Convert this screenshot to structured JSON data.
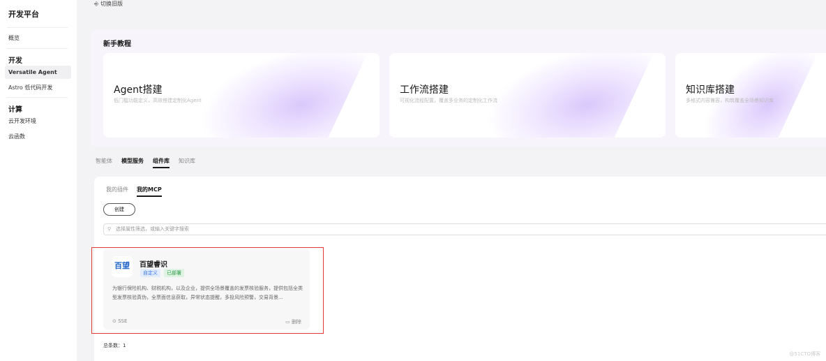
{
  "sidebar": {
    "title": "开发平台",
    "overview": "概览",
    "group_dev": "开发",
    "versatile": "Versatile Agent",
    "astro": "Astro 低代码开发",
    "group_compute": "计算",
    "cloud_dev": "云开发环境",
    "cloud_func": "云函数"
  },
  "header": {
    "switch_label": "切换旧版"
  },
  "tutorial": {
    "title": "新手教程",
    "cards": [
      {
        "title": "Agent搭建",
        "subtitle": "低门槛功能定义，高效搭建定制化Agent"
      },
      {
        "title": "工作流搭建",
        "subtitle": "可视化流程配置，覆盖多业务的定制化工作流"
      },
      {
        "title": "知识库搭建",
        "subtitle": "多格式内容兼容，构筑覆盖全场景知识库"
      }
    ]
  },
  "tabs": [
    "智能体",
    "模型服务",
    "组件库",
    "知识库"
  ],
  "subtabs": [
    "我的插件",
    "我的MCP"
  ],
  "create_label": "创建",
  "search_placeholder": "选择属性筛选，或输入关键字搜索",
  "mcp_card": {
    "logo": "百望",
    "name": "百望睿识",
    "tags": [
      "自定义",
      "已部署"
    ],
    "description": "为银行保险机构、财税机构，以及企业，提供全场景覆盖的发票核验服务，提供包括全类型发票核验真伪，全票面信息获取，异常状态提醒，多投风险预警，交易背景...",
    "protocol": "SSE",
    "delete_label": "删除"
  },
  "total": "总条数：1",
  "watermark": "@51CTO博客"
}
